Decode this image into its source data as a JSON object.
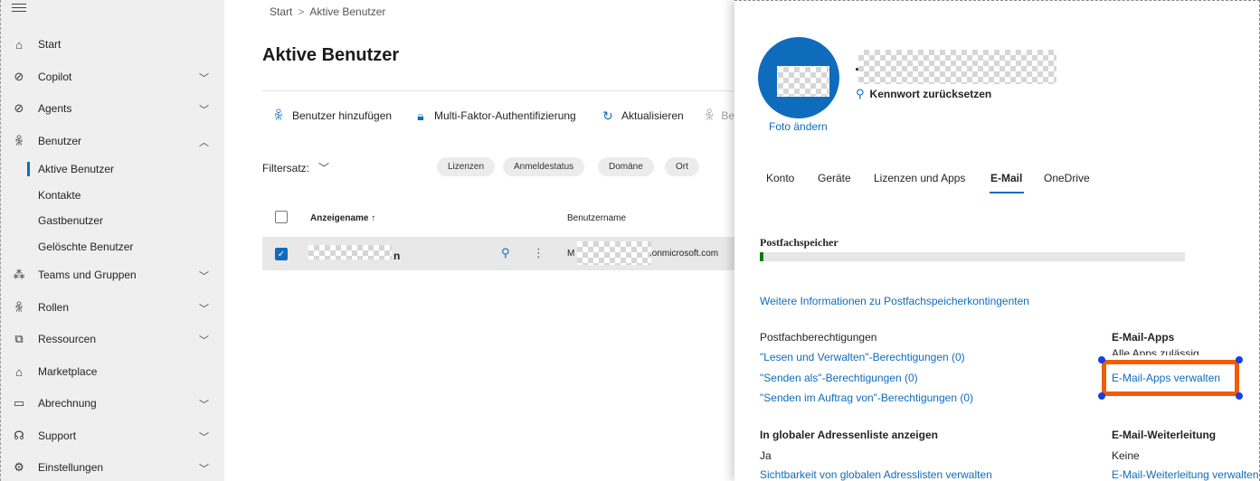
{
  "breadcrumb": {
    "root": "Start",
    "separator": ">",
    "current": "Aktive Benutzer"
  },
  "sidebar": {
    "items": [
      {
        "label": "Start",
        "icon": "home-icon"
      },
      {
        "label": "Copilot",
        "icon": "copilot-icon"
      },
      {
        "label": "Agents",
        "icon": "agents-icon"
      },
      {
        "label": "Benutzer",
        "icon": "person-icon"
      },
      {
        "label": "Teams und Gruppen",
        "icon": "teams-icon"
      },
      {
        "label": "Rollen",
        "icon": "roles-icon"
      },
      {
        "label": "Ressourcen",
        "icon": "resources-icon"
      },
      {
        "label": "Marketplace",
        "icon": "marketplace-icon"
      },
      {
        "label": "Abrechnung",
        "icon": "billing-icon"
      },
      {
        "label": "Support",
        "icon": "support-icon"
      },
      {
        "label": "Einstellungen",
        "icon": "settings-icon"
      }
    ],
    "benutzer_sub": [
      "Aktive Benutzer",
      "Kontakte",
      "Gastbenutzer",
      "Gelöschte Benutzer"
    ]
  },
  "main": {
    "title": "Aktive Benutzer",
    "commands": [
      "Benutzer hinzufügen",
      "Multi-Faktor-Authentifizierung",
      "Aktualisieren",
      "Be"
    ],
    "filterset_label": "Filtersatz:",
    "chips": [
      "Lizenzen",
      "Anmeldestatus",
      "Domäne",
      "Ort"
    ],
    "columns": {
      "display_name": "Anzeigename ↑",
      "username": "Benutzername"
    },
    "row": {
      "name_suffix": "n",
      "user_prefix": "M",
      "user_suffix": ".onmicrosoft.com"
    }
  },
  "panel": {
    "photo_change": "Foto ändern",
    "name_prefix": ".",
    "reset_password": "Kennwort zurücksetzen",
    "tabs": [
      "Konto",
      "Geräte",
      "Lizenzen und Apps",
      "E-Mail",
      "OneDrive"
    ],
    "active_tab": "E-Mail",
    "mailbox_storage": {
      "title": "Postfachspeicher",
      "usage_fraction": 0.008
    },
    "more_info_link": "Weitere Informationen zu Postfachspeicherkontingenten",
    "mailbox_permissions": {
      "title": "Postfachberechtigungen",
      "links": [
        "\"Lesen und Verwalten\"-Berechtigungen (0)",
        "\"Senden als\"-Berechtigungen (0)",
        "\"Senden im Auftrag von\"-Berechtigungen (0)"
      ]
    },
    "email_apps": {
      "title": "E-Mail-Apps",
      "status": "Alle Apps zulässig",
      "manage_link": "E-Mail-Apps verwalten"
    },
    "gal": {
      "title": "In globaler Adressenliste anzeigen",
      "value": "Ja",
      "link": "Sichtbarkeit von globalen Adresslisten verwalten"
    },
    "forwarding": {
      "title": "E-Mail-Weiterleitung",
      "value": "Keine",
      "link": "E-Mail-Weiterleitung verwalten"
    }
  },
  "colors": {
    "accent": "#0f6cbd",
    "highlight": "#f25c05",
    "storage": "#107c10"
  }
}
